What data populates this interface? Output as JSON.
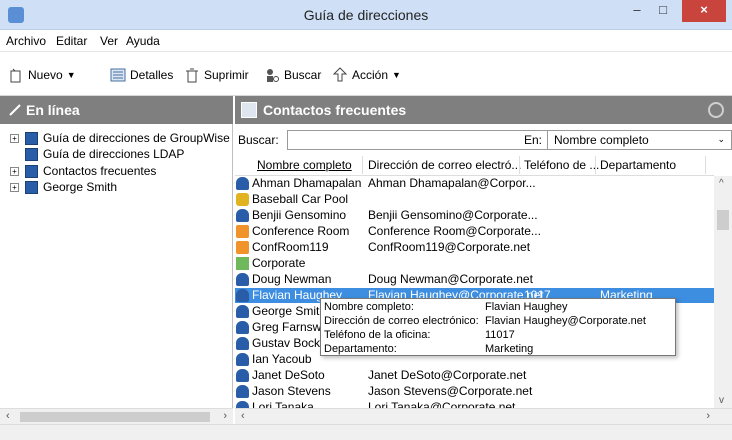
{
  "window": {
    "title": "Guía de direcciones",
    "minimize": "–",
    "maximize": "□",
    "close": "×"
  },
  "menu": [
    "Archivo",
    "Editar",
    "Ver",
    "Ayuda"
  ],
  "toolbar": {
    "new_label": "Nuevo",
    "details_label": "Detalles",
    "delete_label": "Suprimir",
    "search_label": "Buscar",
    "action_label": "Acción"
  },
  "left_pane": {
    "header": "En línea",
    "tree": [
      {
        "label": "Guía de direcciones de GroupWise",
        "expander": "+"
      },
      {
        "label": "Guía de direcciones LDAP",
        "expander": ""
      },
      {
        "label": "Contactos frecuentes",
        "expander": "+"
      },
      {
        "label": "George Smith",
        "expander": "+"
      }
    ]
  },
  "right_pane": {
    "header": "Contactos frecuentes",
    "search_label": "Buscar:",
    "search_value": "",
    "in_label": "En:",
    "in_value": "Nombre completo",
    "columns": [
      "Nombre completo",
      "Dirección de correo electró...",
      "Teléfono de ...",
      "Departamento"
    ],
    "rows": [
      {
        "icon": "person-icon",
        "name": "Ahman Dhamapalan",
        "email": "Ahman Dhamapalan@Corpor...",
        "phone": "",
        "dept": ""
      },
      {
        "icon": "group-icon",
        "name": "Baseball Car Pool",
        "email": "",
        "phone": "",
        "dept": ""
      },
      {
        "icon": "person-icon",
        "name": "Benjii Gensomino",
        "email": "Benjii Gensomino@Corporate...",
        "phone": "",
        "dept": ""
      },
      {
        "icon": "resource-icon",
        "name": "Conference Room",
        "email": "Conference Room@Corporate...",
        "phone": "",
        "dept": ""
      },
      {
        "icon": "resource-icon",
        "name": "ConfRoom119",
        "email": "ConfRoom119@Corporate.net",
        "phone": "",
        "dept": ""
      },
      {
        "icon": "organization-icon",
        "name": "Corporate",
        "email": "",
        "phone": "",
        "dept": ""
      },
      {
        "icon": "person-icon",
        "name": "Doug Newman",
        "email": "Doug Newman@Corporate.net",
        "phone": "",
        "dept": ""
      },
      {
        "icon": "person-icon",
        "name": "Flavian Haughey",
        "email": "Flavian Haughey@Corporate.net",
        "phone": "1017",
        "dept": "Marketing",
        "selected": true
      },
      {
        "icon": "person-icon",
        "name": "George Smith",
        "email": "",
        "phone": "",
        "dept": ""
      },
      {
        "icon": "person-icon",
        "name": "Greg Farnsworth",
        "email": "",
        "phone": "",
        "dept": ""
      },
      {
        "icon": "person-icon",
        "name": "Gustav Bock",
        "email": "",
        "phone": "",
        "dept": ""
      },
      {
        "icon": "person-icon",
        "name": "Ian Yacoub",
        "email": "",
        "phone": "",
        "dept": ""
      },
      {
        "icon": "person-icon",
        "name": "Janet DeSoto",
        "email": "Janet DeSoto@Corporate.net",
        "phone": "",
        "dept": ""
      },
      {
        "icon": "person-icon",
        "name": "Jason Stevens",
        "email": "Jason Stevens@Corporate.net",
        "phone": "",
        "dept": ""
      },
      {
        "icon": "person-icon",
        "name": "Lori Tanaka",
        "email": "Lori Tanaka@Corporate.net",
        "phone": "",
        "dept": ""
      }
    ]
  },
  "tooltip": {
    "fields": [
      {
        "key": "Nombre completo:",
        "value": "Flavian Haughey"
      },
      {
        "key": "Dirección de correo electrónico:",
        "value": "Flavian Haughey@Corporate.net"
      },
      {
        "key": "Teléfono de la oficina:",
        "value": "11017"
      },
      {
        "key": "Departamento:",
        "value": "Marketing"
      }
    ]
  },
  "colors": {
    "selection": "#3d8ee0",
    "pane_header": "#7f7f7f",
    "titlebar": "#cfe0f6",
    "close_button": "#c9443d"
  }
}
